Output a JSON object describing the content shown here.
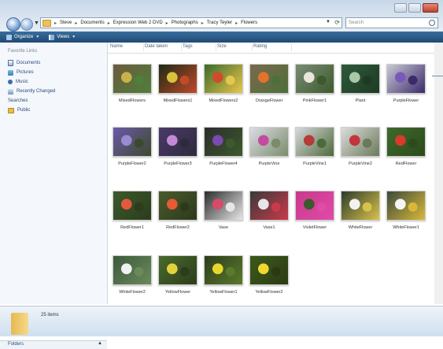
{
  "window": {
    "breadcrumbs": [
      "Steve",
      "Documents",
      "Expression Web 2 DVD",
      "Photographs",
      "Tracy Teyler",
      "Flowers"
    ],
    "search_placeholder": "Search"
  },
  "toolbar": {
    "organize": "Organize",
    "views": "Views"
  },
  "sidebar": {
    "title": "Favorite Links",
    "items": [
      {
        "label": "Documents",
        "icon": "documents-icon"
      },
      {
        "label": "Pictures",
        "icon": "pictures-icon"
      },
      {
        "label": "Music",
        "icon": "music-icon"
      },
      {
        "label": "Recently Changed",
        "icon": "recently-changed-icon"
      },
      {
        "label": "Searches",
        "icon": "searches-icon"
      },
      {
        "label": "Public",
        "icon": "public-folder-icon"
      }
    ],
    "folders_label": "Folders"
  },
  "columns": [
    "Name",
    "Date taken",
    "Tags",
    "Size",
    "Rating"
  ],
  "files": [
    {
      "name": "MixedFlowers",
      "colors": [
        "#6b5a3c",
        "#c9b24a",
        "#4f7f3c"
      ]
    },
    {
      "name": "MixedFlowers1",
      "colors": [
        "#1c2a14",
        "#d8c23c",
        "#c04a2a"
      ]
    },
    {
      "name": "MixedFlowers2",
      "colors": [
        "#3c6a2c",
        "#d24a2c",
        "#e7c64a"
      ]
    },
    {
      "name": "OrangeFlower",
      "colors": [
        "#7a6a4c",
        "#e3732c",
        "#4e6e3a"
      ]
    },
    {
      "name": "PinkFlower1",
      "colors": [
        "#7a8c74",
        "#e9e6dc",
        "#3c5a2c"
      ]
    },
    {
      "name": "Plant",
      "colors": [
        "#2e5a3a",
        "#a8c8a8",
        "#1e3a24"
      ]
    },
    {
      "name": "PurpleFlower",
      "colors": [
        "#c9c9d6",
        "#7a5ab8",
        "#3c2a6a"
      ]
    },
    {
      "name": "PurpleFlower2",
      "colors": [
        "#6a5aa8",
        "#9b8ad0",
        "#3c4a2c"
      ]
    },
    {
      "name": "PurpleFlower3",
      "colors": [
        "#4a3a6a",
        "#c48ad6",
        "#2e2a3c"
      ]
    },
    {
      "name": "PurpleFlower4",
      "colors": [
        "#2c2c2c",
        "#7a4ab0",
        "#3c5a2c"
      ]
    },
    {
      "name": "PurpleVine",
      "colors": [
        "#dcdce4",
        "#c44aa0",
        "#7a8c6a"
      ]
    },
    {
      "name": "PurpleVine1",
      "colors": [
        "#d8d8de",
        "#b83a3a",
        "#4c6a3a"
      ]
    },
    {
      "name": "PurpleVine2",
      "colors": [
        "#dcdcdc",
        "#c4343a",
        "#6a7a5a"
      ]
    },
    {
      "name": "RedFlower",
      "colors": [
        "#3c6a2c",
        "#d83a2c",
        "#2c4a1c"
      ]
    },
    {
      "name": "RedFlower1",
      "colors": [
        "#3c5a2c",
        "#e25a3c",
        "#2c3c1c"
      ]
    },
    {
      "name": "RedFlower2",
      "colors": [
        "#4a5a2c",
        "#e65a34",
        "#2c3a1c"
      ]
    },
    {
      "name": "Vase",
      "colors": [
        "#2c2c2c",
        "#d84a6a",
        "#e6e6e6"
      ]
    },
    {
      "name": "Vase1",
      "colors": [
        "#3a3a3a",
        "#e6e6e6",
        "#c83a4a"
      ]
    },
    {
      "name": "VioletFlower",
      "colors": [
        "#c83a8a",
        "#3c5a2c",
        "#e04aa8"
      ]
    },
    {
      "name": "WhiteFlower",
      "colors": [
        "#2c3c2c",
        "#f2f2f2",
        "#d8c24a"
      ]
    },
    {
      "name": "WhiteFlower1",
      "colors": [
        "#3c4a3c",
        "#f4f4f4",
        "#d8b83a"
      ]
    },
    {
      "name": "WhiteFlower2",
      "colors": [
        "#3c5a3c",
        "#f2f2f2",
        "#6a8a5a"
      ]
    },
    {
      "name": "YellowFlower",
      "colors": [
        "#4a6a2c",
        "#e2d23c",
        "#2c3c1c"
      ]
    },
    {
      "name": "YellowFlower1",
      "colors": [
        "#2c3c1c",
        "#e8d82c",
        "#5a7a2c"
      ]
    },
    {
      "name": "YellowFlower2",
      "colors": [
        "#3c5a1c",
        "#f0d82c",
        "#2c3a14"
      ]
    }
  ],
  "status": {
    "item_count": "25 items"
  }
}
